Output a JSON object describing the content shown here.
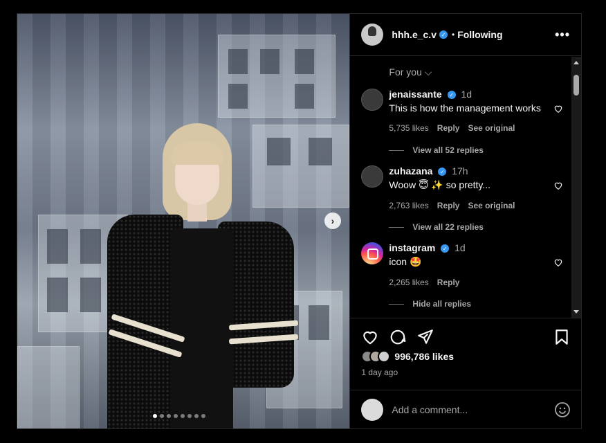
{
  "post": {
    "username": "hhh.e_c.v",
    "separator": "•",
    "follow_state": "Following",
    "more_icon": "•••",
    "image_dots_total": 8,
    "image_dot_active": 1
  },
  "comments_section": {
    "sort_label": "For you ⌵",
    "comments": [
      {
        "username": "jenaissante",
        "time": "1d",
        "text": "This is how the management works",
        "likes": "5,735 likes",
        "reply": "Reply",
        "see_original": "See original",
        "replies_label": "View all 52 replies"
      },
      {
        "username": "zuhazana",
        "time": "17h",
        "text": "Woow 😇 ✨ so pretty...",
        "likes": "2,763 likes",
        "reply": "Reply",
        "see_original": "See original",
        "replies_label": "View all 22 replies"
      },
      {
        "username": "instagram",
        "time": "1d",
        "text": "icon 🤩",
        "likes": "2,265 likes",
        "reply": "Reply",
        "replies_label": "Hide all replies"
      }
    ]
  },
  "actions": {
    "likes_count": "996,786 likes",
    "time_ago": "1 day ago",
    "icons": [
      "heart-icon",
      "comment-icon",
      "share-icon",
      "bookmark-icon"
    ]
  },
  "composer": {
    "placeholder": "Add a comment...",
    "emoji_icon": "smiley-icon"
  },
  "colors": {
    "verified": "#3897f0",
    "muted": "#a8a8a8",
    "border": "#262626"
  }
}
